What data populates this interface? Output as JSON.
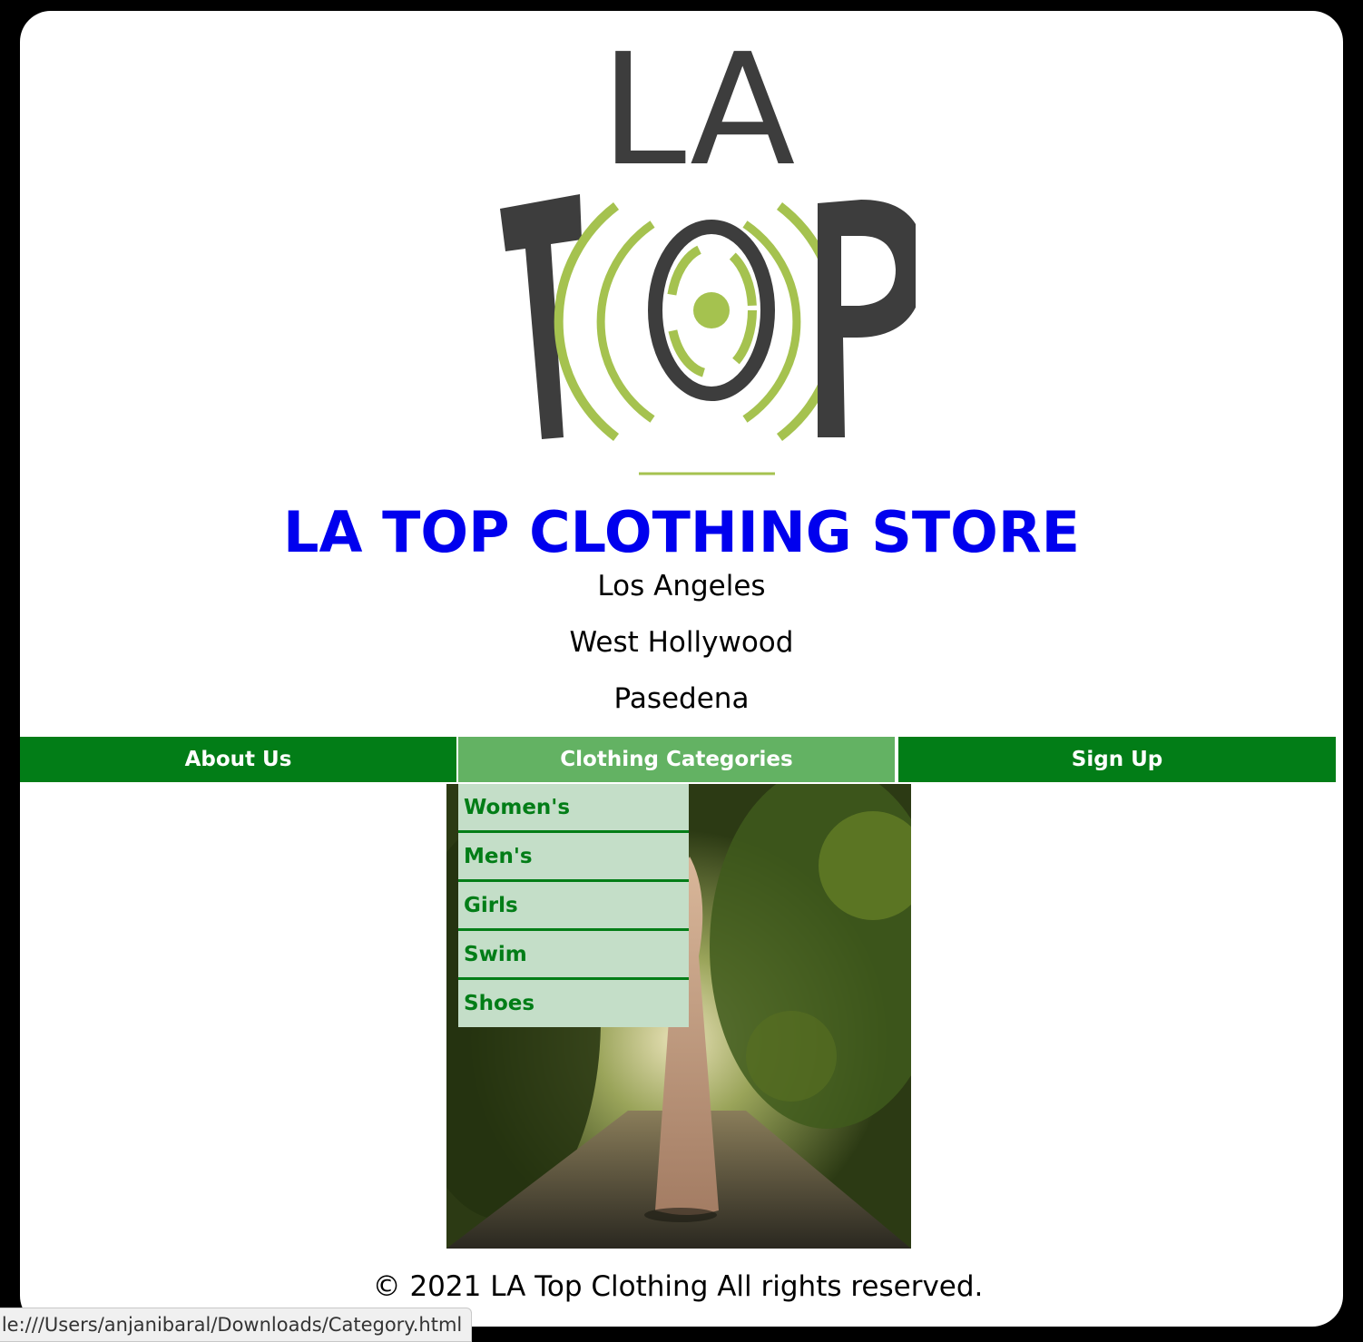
{
  "logo": {
    "line1": "LA",
    "line2": "TOP",
    "colors": {
      "text": "#3d3d3d",
      "accent": "#a5c24f"
    }
  },
  "header": {
    "title": "LA TOP CLOTHING STORE",
    "title_color": "#0000ee",
    "locations": [
      "Los Angeles",
      "West Hollywood",
      "Pasedena"
    ]
  },
  "nav": {
    "items": [
      {
        "label": "About Us"
      },
      {
        "label": "Clothing Categories",
        "active": true
      },
      {
        "label": "Sign Up"
      }
    ],
    "colors": {
      "bar": "#027d17",
      "active": "#63b263",
      "text": "#ffffff"
    }
  },
  "dropdown": {
    "items": [
      "Women's",
      "Men's",
      "Girls",
      "Swim",
      "Shoes"
    ],
    "colors": {
      "background": "#c4dec8",
      "text": "#027d17"
    }
  },
  "hero": {
    "image_icon": "woman-in-dress-on-forest-road-photo"
  },
  "footer": {
    "text": "© 2021 LA Top Clothing All rights reserved."
  },
  "statusbar": {
    "url": "ile:///Users/anjanibaral/Downloads/Category.html"
  }
}
